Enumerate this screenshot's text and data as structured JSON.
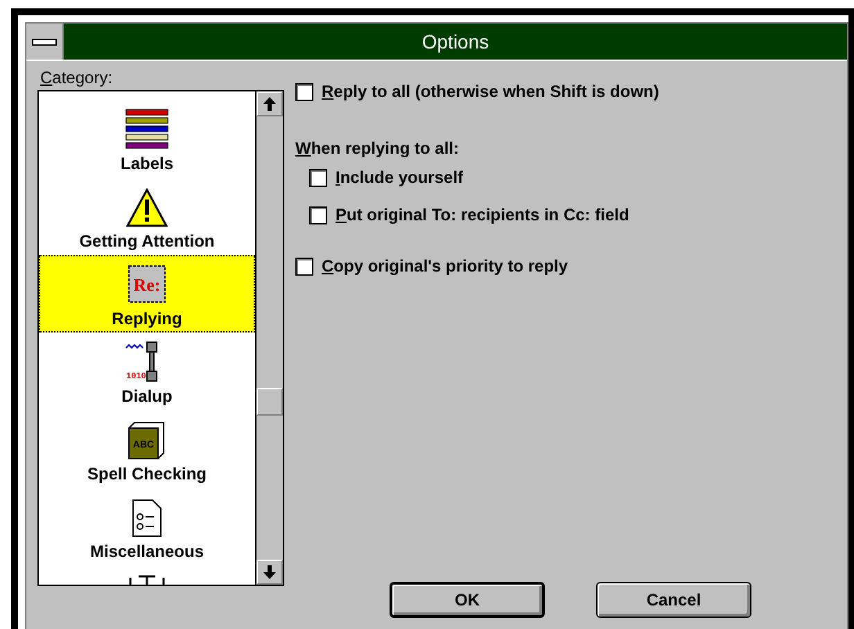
{
  "window": {
    "title": "Options"
  },
  "category": {
    "label": "Category:",
    "items": [
      {
        "label": "Labels",
        "selected": false
      },
      {
        "label": "Getting Attention",
        "selected": false
      },
      {
        "label": "Replying",
        "selected": true,
        "icon_text": "Re:"
      },
      {
        "label": "Dialup",
        "selected": false,
        "icon_text": "1010"
      },
      {
        "label": "Spell Checking",
        "selected": false,
        "icon_text": "ABC"
      },
      {
        "label": "Miscellaneous",
        "selected": false
      }
    ]
  },
  "options": [
    {
      "kind": "checkbox",
      "label": "Reply to all (otherwise when Shift is down)",
      "checked": false
    },
    {
      "kind": "heading",
      "label": "When replying to all:"
    },
    {
      "kind": "subcheckbox",
      "label": "Include yourself",
      "checked": false
    },
    {
      "kind": "subcheckbox",
      "label": "Put original To: recipients in Cc: field",
      "checked": false
    },
    {
      "kind": "checkbox",
      "label": "Copy original's priority to reply",
      "checked": false
    }
  ],
  "buttons": [
    {
      "label": "OK",
      "default": true
    },
    {
      "label": "Cancel",
      "default": false
    }
  ]
}
